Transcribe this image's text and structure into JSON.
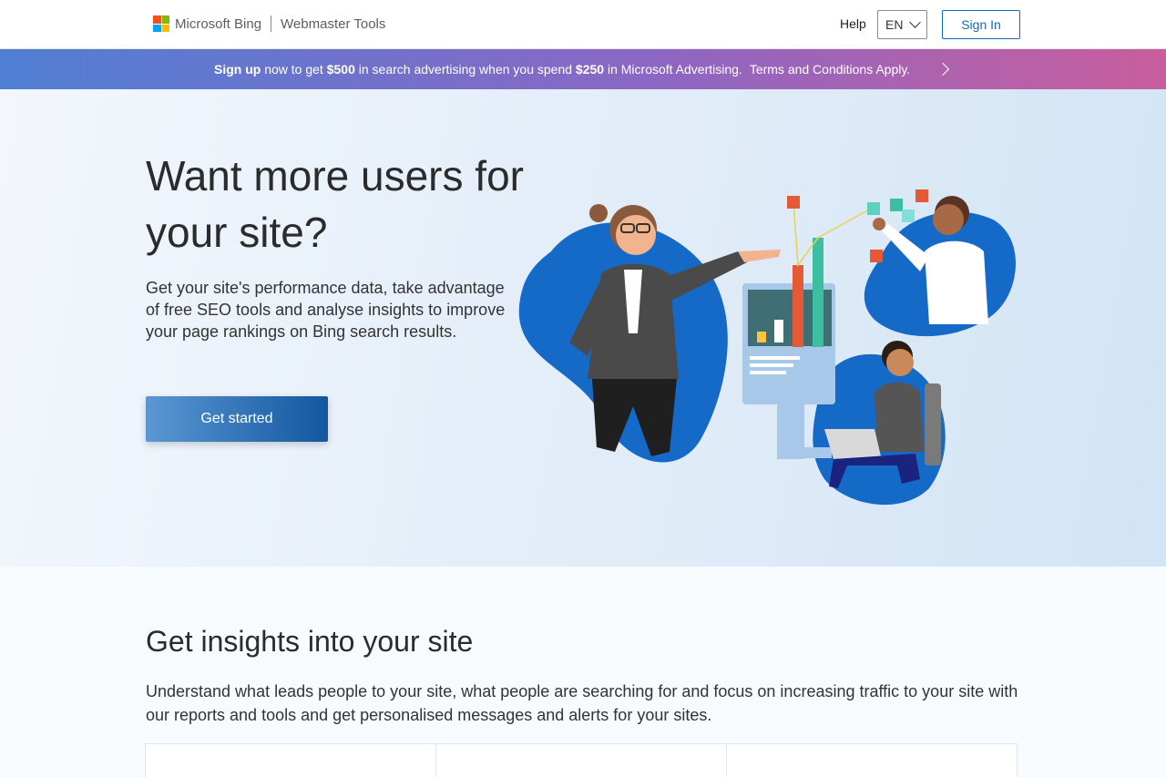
{
  "header": {
    "brand_name": "Microsoft Bing",
    "product_name": "Webmaster Tools",
    "help_label": "Help",
    "language": "EN",
    "signin_label": "Sign In"
  },
  "banner": {
    "signup": "Sign up",
    "text1": " now to get ",
    "amount1": "$500",
    "text2": " in search advertising when you spend ",
    "amount2": "$250",
    "text3": " in Microsoft Advertising.",
    "terms": "Terms and Conditions Apply."
  },
  "hero": {
    "title": "Want more users for your site?",
    "description": "Get your site's performance data, take advantage of free SEO tools and analyse insights to improve your page rankings on Bing search results.",
    "cta_label": "Get started"
  },
  "insights": {
    "title": "Get insights into your site",
    "description": "Understand what leads people to your site, what people are searching for and focus on increasing traffic to your site with our reports and tools and get personalised messages and alerts for your sites."
  },
  "colors": {
    "accent": "#0f6cbd",
    "banner_start": "#4f7fd3",
    "banner_end": "#c95e9d"
  }
}
